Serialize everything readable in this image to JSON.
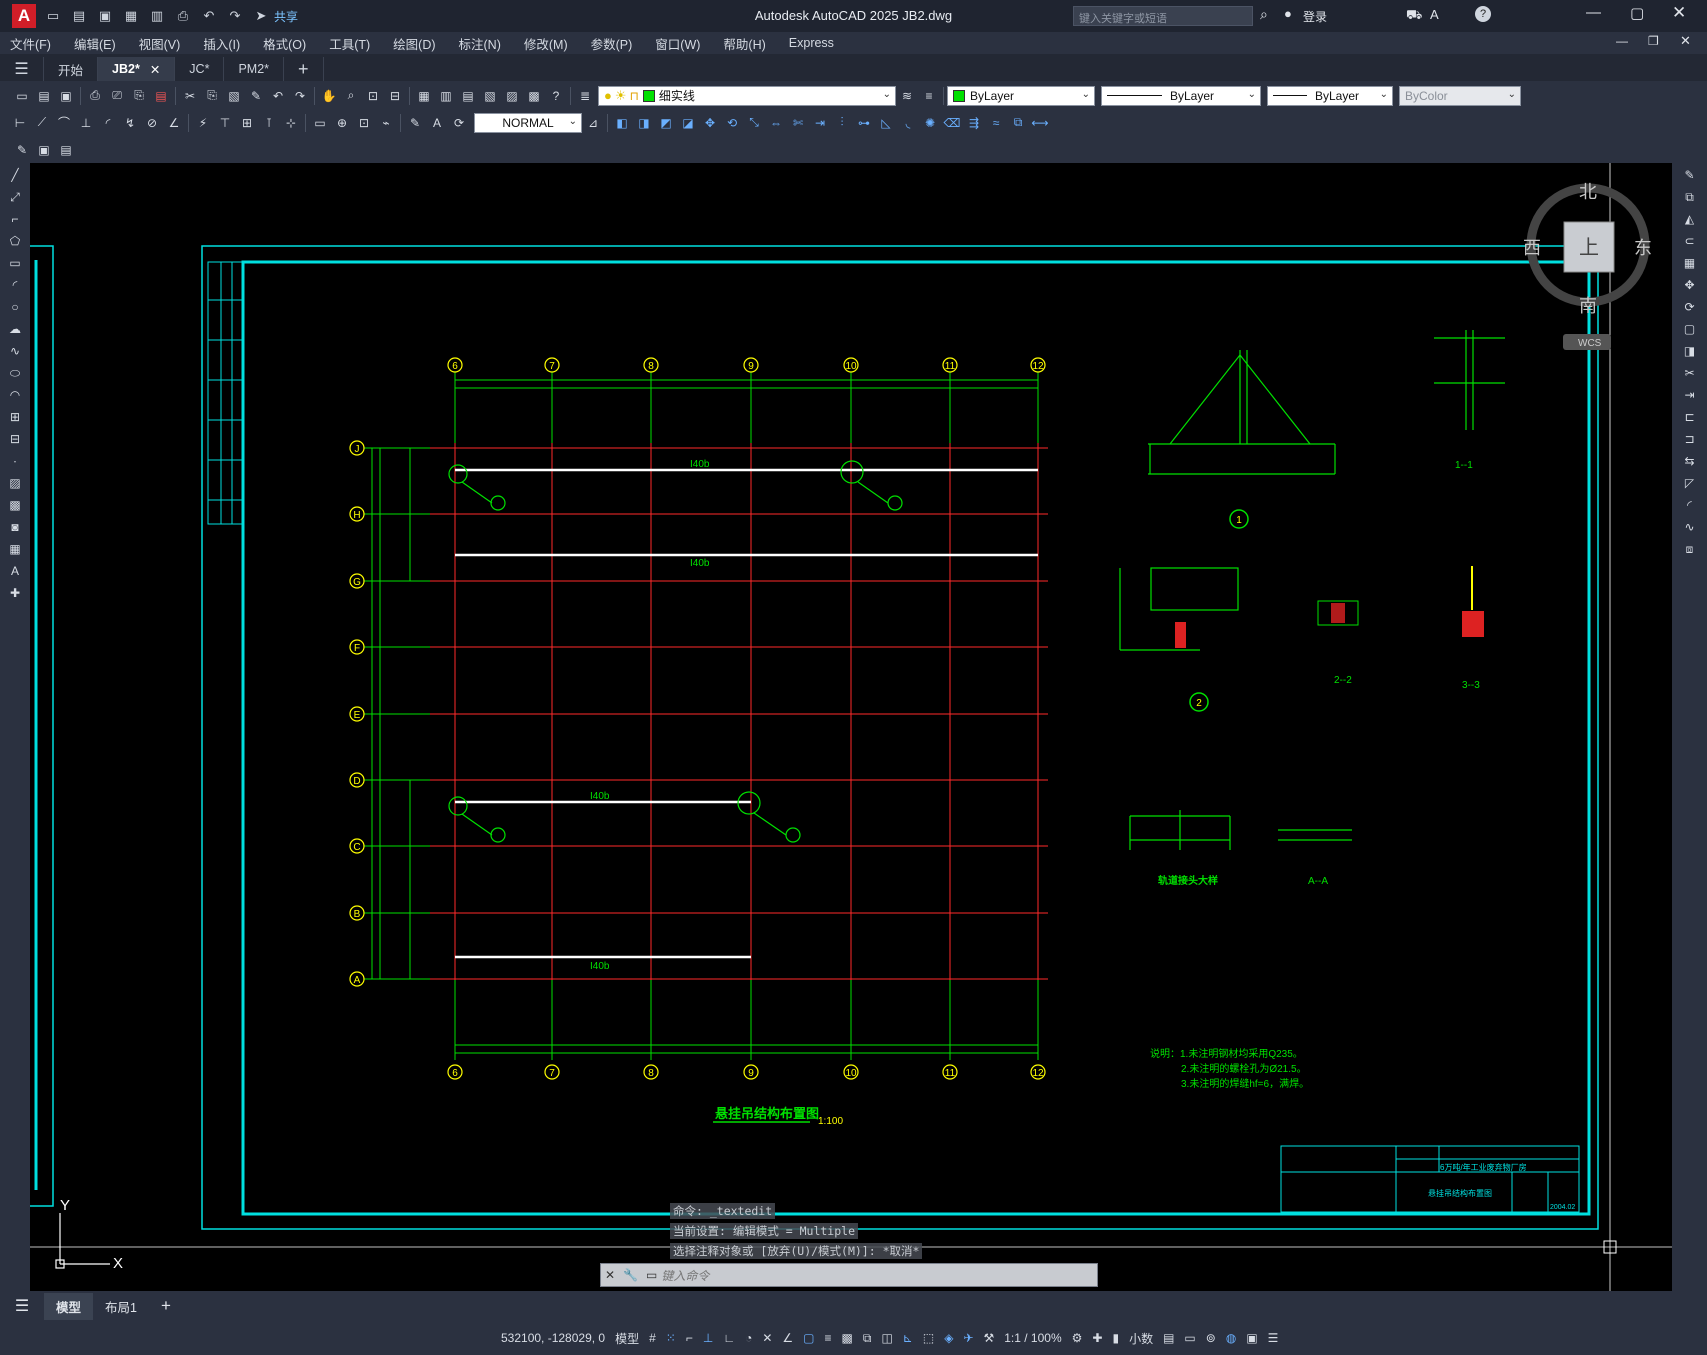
{
  "titlebar": {
    "title": "Autodesk AutoCAD 2025    JB2.dwg",
    "share": "共享",
    "search_placeholder": "键入关键字或短语",
    "login": "登录"
  },
  "menu": [
    "文件(F)",
    "编辑(E)",
    "视图(V)",
    "插入(I)",
    "格式(O)",
    "工具(T)",
    "绘图(D)",
    "标注(N)",
    "修改(M)",
    "参数(P)",
    "窗口(W)",
    "帮助(H)",
    "Express"
  ],
  "tabs": {
    "start": "开始",
    "docs": [
      {
        "label": "JB2*",
        "active": true
      },
      {
        "label": "JC*",
        "active": false
      },
      {
        "label": "PM2*",
        "active": false
      }
    ]
  },
  "props": {
    "layer": "细实线",
    "color": "ByLayer",
    "linetype": "ByLayer",
    "lineweight": "ByLayer",
    "plotstyle": "ByColor",
    "dimstyle": "NORMAL"
  },
  "viewcube": {
    "north": "北",
    "south": "南",
    "east": "东",
    "west": "西",
    "top": "上",
    "wcs": "WCS"
  },
  "drawing": {
    "cols": [
      "6",
      "7",
      "8",
      "9",
      "10",
      "11",
      "12"
    ],
    "rows": [
      "J",
      "H",
      "G",
      "F",
      "E",
      "D",
      "C",
      "B",
      "A"
    ],
    "beam": "I40b",
    "plan_title": "悬挂吊结构布置图",
    "plan_scale": "1:100",
    "detail1": "1",
    "detail2": "2",
    "sec11": "1--1",
    "sec22": "2--2",
    "sec33": "3--3",
    "secAA": "A--A",
    "rail_title": "轨道接头大样",
    "notes": [
      "说明：1.未注明钢材均采用Q235。",
      "2.未注明的螺栓孔为Ø21.5。",
      "3.未注明的焊缝hf=6，满焊。"
    ],
    "titleblock": {
      "project": "6万吨/年工业废弃物厂房",
      "drawing": "悬挂吊结构布置图",
      "date": "2004.02"
    }
  },
  "command": {
    "history": [
      "命令: _textedit",
      "当前设置: 编辑模式 = Multiple",
      "选择注释对象或 [放弃(U)/模式(M)]: *取消*"
    ],
    "placeholder": "键入命令"
  },
  "layout_tabs": {
    "model": "模型",
    "layout1": "布局1"
  },
  "status": {
    "coords": "532100, -128029, 0",
    "mode": "模型",
    "scale": "1:1 / 100%",
    "units": "小数"
  }
}
